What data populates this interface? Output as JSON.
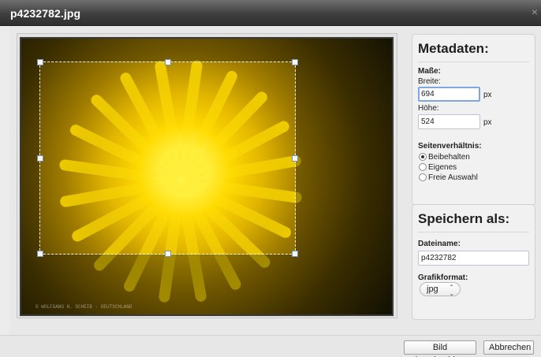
{
  "window": {
    "title": "p4232782.jpg",
    "close_icon": "close-icon"
  },
  "image": {
    "watermark": "© WOLFGANG H. SCHEIB - DEUTSCHLAND"
  },
  "metadata": {
    "title": "Metadaten:",
    "dimensions_label": "Maße:",
    "width_label": "Breite:",
    "width_value": "694",
    "width_unit": "px",
    "height_label": "Höhe:",
    "height_value": "524",
    "height_unit": "px",
    "aspect_label": "Seitenverhältnis:",
    "aspect_options": [
      {
        "label": "Beibehalten",
        "checked": true
      },
      {
        "label": "Eigenes",
        "checked": false
      },
      {
        "label": "Freie Auswahl",
        "checked": false
      }
    ]
  },
  "save_as": {
    "title": "Speichern als:",
    "filename_label": "Dateiname:",
    "filename_value": "p4232782",
    "format_label": "Grafikformat:",
    "format_value": "jpg"
  },
  "footer": {
    "crop_button": "Bild beschneiden",
    "cancel_button": "Abbrechen"
  },
  "colors": {
    "title_bar": "#3f3f3f",
    "focus_border": "#7fa6de",
    "flower_yellow": "#ffd900"
  }
}
